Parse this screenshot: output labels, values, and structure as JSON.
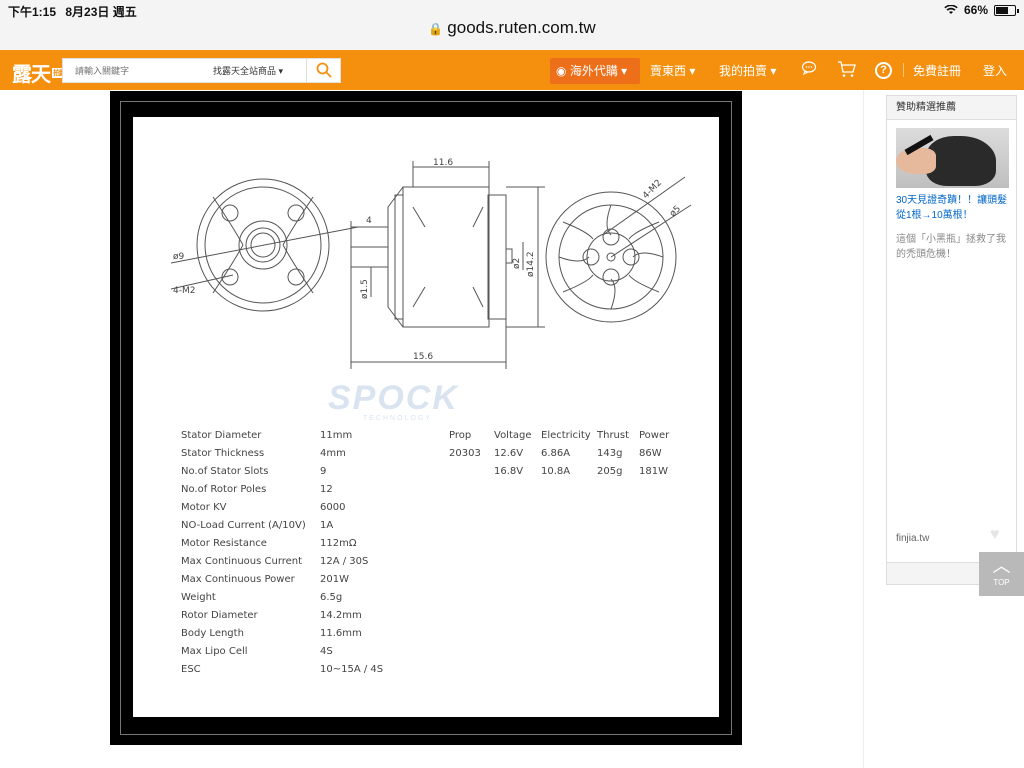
{
  "status_bar": {
    "time": "下午1:15",
    "date": "8月23日 週五",
    "wifi_icon": "wifi-icon",
    "battery": "66%"
  },
  "browser": {
    "url": "goods.ruten.com.tw"
  },
  "header": {
    "logo": "露天",
    "logo_badge": "拍賣",
    "search_placeholder": "請輸入關鍵字",
    "search_scope": "找露天全站商品 ▾",
    "nav_overseas": "海外代購 ▾",
    "nav_sell": "賣東西 ▾",
    "nav_my_auction": "我的拍賣 ▾",
    "register": "免費註冊",
    "login": "登入",
    "accent_color": "#f5900e"
  },
  "product_image": {
    "dimensions": {
      "d_left": "ø9",
      "holes_left": "4-M2",
      "length_top": "11.6",
      "shaft_len": "4",
      "shaft_dia": "ø1.5",
      "bottom_len": "15.6",
      "small_dia": "ø2",
      "body_dia": "ø14.2",
      "holes_right": "4-M2",
      "d_right": "ø5"
    },
    "watermark": "SPOCK",
    "watermark_sub": "TECHNOLOGY",
    "specs": [
      {
        "label": "Stator Diameter",
        "value": "11mm"
      },
      {
        "label": "Stator Thickness",
        "value": "4mm"
      },
      {
        "label": "No.of Stator Slots",
        "value": "9"
      },
      {
        "label": "No.of Rotor Poles",
        "value": "12"
      },
      {
        "label": "Motor KV",
        "value": "6000"
      },
      {
        "label": "NO-Load Current (A/10V)",
        "value": "1A"
      },
      {
        "label": "Motor Resistance",
        "value": "112mΩ"
      },
      {
        "label": "Max Continuous Current",
        "value": "12A / 30S"
      },
      {
        "label": "Max Continuous Power",
        "value": "201W"
      },
      {
        "label": "Weight",
        "value": "6.5g"
      },
      {
        "label": "Rotor Diameter",
        "value": "14.2mm"
      },
      {
        "label": "Body Length",
        "value": "11.6mm"
      },
      {
        "label": "Max Lipo Cell",
        "value": "4S"
      },
      {
        "label": "ESC",
        "value": "10~15A / 4S"
      }
    ],
    "perf_headers": [
      "Prop",
      "Voltage",
      "Electricity",
      "Thrust",
      "Power"
    ],
    "perf_rows": [
      [
        "20303",
        "12.6V",
        "6.86A",
        "143g",
        "86W"
      ],
      [
        "",
        "16.8V",
        "10.8A",
        "205g",
        "181W"
      ]
    ]
  },
  "sidebar": {
    "title": "贊助精選推薦",
    "ad_title": "30天見證奇蹟！！讓頭髮從1根→10萬根！",
    "ad_desc": "這個「小黑瓶」拯救了我的禿頭危機！",
    "ad_source": "finjia.tw",
    "top_label": "TOP"
  }
}
